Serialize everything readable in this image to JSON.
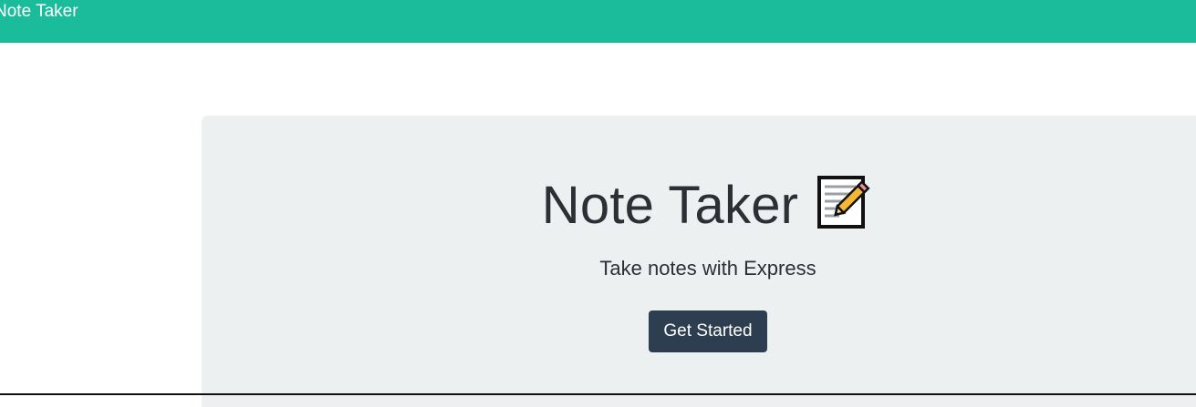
{
  "navbar": {
    "brand": "Note Taker",
    "background_color": "#1abc9c"
  },
  "hero": {
    "title": "Note Taker",
    "title_icon": "memo-icon",
    "subtitle": "Take notes with Express",
    "cta_label": "Get Started",
    "cta_color": "#2c3e50",
    "panel_color": "#ecf0f1"
  }
}
